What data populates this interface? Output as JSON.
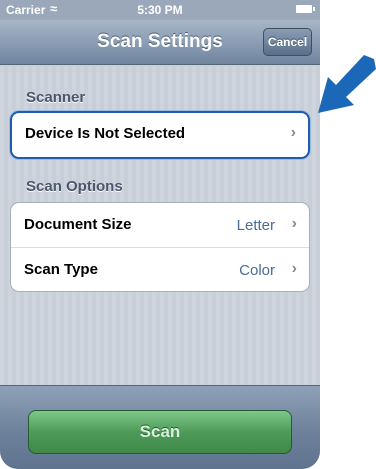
{
  "status_bar": {
    "carrier": "Carrier",
    "time": "5:30 PM"
  },
  "nav": {
    "title": "Scan Settings",
    "cancel_label": "Cancel"
  },
  "sections": {
    "scanner": {
      "header": "Scanner",
      "device_label": "Device Is Not Selected"
    },
    "scan_options": {
      "header": "Scan Options",
      "document_size_label": "Document Size",
      "document_size_value": "Letter",
      "scan_type_label": "Scan Type",
      "scan_type_value": "Color"
    }
  },
  "toolbar": {
    "scan_label": "Scan"
  },
  "colors": {
    "callout_arrow": "#1b68b8",
    "highlight_border": "#1f5cb0",
    "scan_button": "#4e9a58"
  },
  "icons": [
    "wifi-icon",
    "battery-icon",
    "chevron-right-icon",
    "callout-arrow-icon"
  ]
}
